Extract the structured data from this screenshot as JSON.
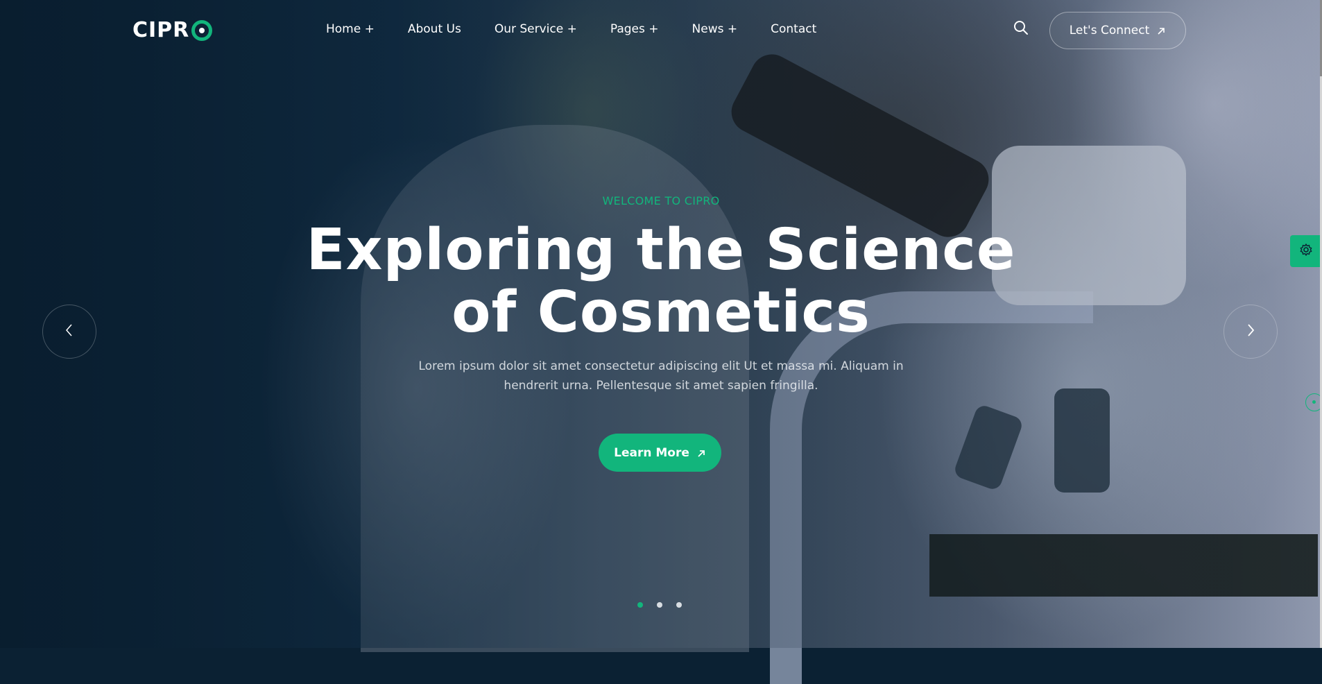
{
  "brand": {
    "logo_text": "CIPR",
    "logo_accent_color": "#12b57c"
  },
  "nav": {
    "items": [
      {
        "label": "Home +"
      },
      {
        "label": "About Us"
      },
      {
        "label": "Our Service +"
      },
      {
        "label": "Pages +"
      },
      {
        "label": "News +"
      },
      {
        "label": "Contact"
      }
    ]
  },
  "header": {
    "search_icon": "search-icon",
    "connect_label": "Let's Connect",
    "connect_icon": "arrow-up-right-icon"
  },
  "hero": {
    "eyebrow": "WELCOME TO CIPRO",
    "headline_line1": "Exploring the Science",
    "headline_line2": "of Cosmetics",
    "description_line1": "Lorem ipsum dolor sit amet consectetur adipiscing elit Ut et massa mi. Aliquam in",
    "description_line2": "hendrerit urna. Pellentesque sit amet sapien fringilla.",
    "cta_label": "Learn More",
    "cta_icon": "arrow-up-right-icon"
  },
  "slider": {
    "prev_icon": "chevron-left-icon",
    "next_icon": "chevron-right-icon",
    "total_slides": 3,
    "active_slide": 1
  },
  "floating": {
    "settings_icon": "gear-icon"
  },
  "colors": {
    "accent": "#12b57c",
    "overlay": "#0b2133"
  }
}
